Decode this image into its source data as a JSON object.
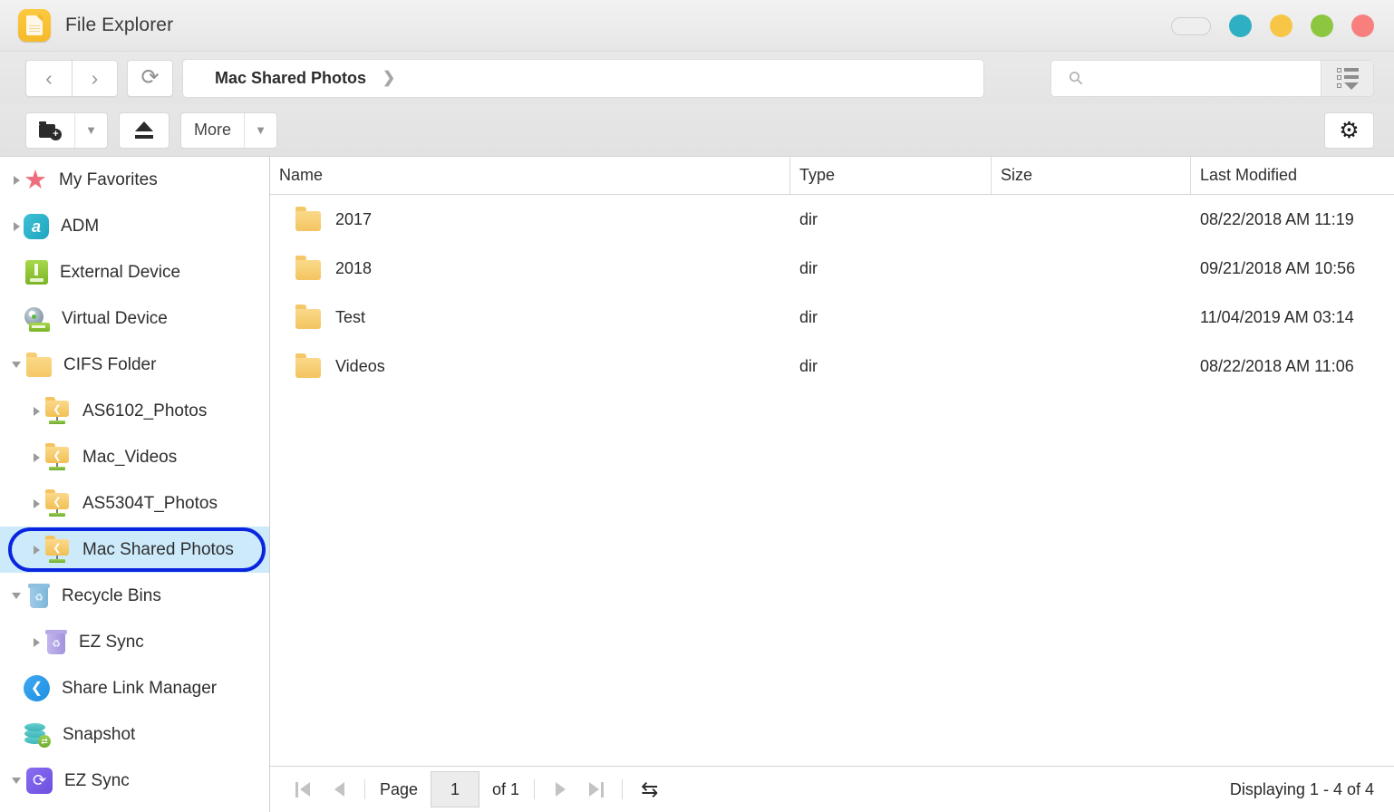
{
  "window": {
    "title": "File Explorer",
    "app_icon": "file-explorer-icon",
    "controls": {
      "pill": "",
      "dots": [
        {
          "name": "teal-dot",
          "color": "#2FAFC2"
        },
        {
          "name": "yellow-dot",
          "color": "#F7C646"
        },
        {
          "name": "green-dot",
          "color": "#8DC63F"
        },
        {
          "name": "red-dot",
          "color": "#F7807F"
        }
      ]
    }
  },
  "toolbar": {
    "back_icon": "‹",
    "forward_icon": "›",
    "refresh_icon": "⟳",
    "breadcrumb": {
      "label": "Mac Shared Photos",
      "separator": "❯"
    },
    "search": {
      "value": "",
      "placeholder": "",
      "icon": "search-icon"
    },
    "view_toggle": "view-list-dropdown-icon",
    "new_folder": {
      "icon": "new-folder-icon",
      "caret": "❯"
    },
    "eject": {
      "icon": "eject-icon"
    },
    "more": {
      "label": "More",
      "caret": "❯"
    },
    "settings": {
      "icon": "⚙"
    }
  },
  "sidebar": {
    "items": [
      {
        "label": "My Favorites",
        "icon": "star-icon",
        "twisty": "closed",
        "indent": 0,
        "selected": false
      },
      {
        "label": "ADM",
        "icon": "adm-icon",
        "twisty": "closed",
        "indent": 0,
        "selected": false
      },
      {
        "label": "External Device",
        "icon": "usb-device-icon",
        "twisty": "none",
        "indent": 0,
        "selected": false
      },
      {
        "label": "Virtual Device",
        "icon": "virtual-disc-icon",
        "twisty": "none",
        "indent": 0,
        "selected": false
      },
      {
        "label": "CIFS Folder",
        "icon": "folder-icon",
        "twisty": "open",
        "indent": 0,
        "selected": false
      },
      {
        "label": "AS6102_Photos",
        "icon": "shared-folder-icon",
        "twisty": "closed",
        "indent": 1,
        "selected": false
      },
      {
        "label": "Mac_Videos",
        "icon": "shared-folder-icon",
        "twisty": "closed",
        "indent": 1,
        "selected": false
      },
      {
        "label": "AS5304T_Photos",
        "icon": "shared-folder-icon",
        "twisty": "closed",
        "indent": 1,
        "selected": false
      },
      {
        "label": "Mac Shared Photos",
        "icon": "shared-folder-icon",
        "twisty": "closed",
        "indent": 1,
        "selected": true
      },
      {
        "label": "Recycle Bins",
        "icon": "trash-icon",
        "twisty": "open",
        "indent": 0,
        "selected": false
      },
      {
        "label": "EZ Sync",
        "icon": "trash-purple-icon",
        "twisty": "closed",
        "indent": 1,
        "selected": false
      },
      {
        "label": "Share Link Manager",
        "icon": "share-link-icon",
        "twisty": "none",
        "indent": 0,
        "selected": false
      },
      {
        "label": "Snapshot",
        "icon": "snapshot-icon",
        "twisty": "none",
        "indent": 0,
        "selected": false
      },
      {
        "label": "EZ Sync",
        "icon": "ezsync-icon",
        "twisty": "open",
        "indent": 0,
        "selected": false
      }
    ],
    "selection_border_color": "#0A25E0",
    "selection_fill_color": "#CDEAFB"
  },
  "filelist": {
    "columns": [
      "Name",
      "Type",
      "Size",
      "Last Modified"
    ],
    "rows": [
      {
        "name": "2017",
        "type": "dir",
        "size": "",
        "modified": "08/22/2018 AM 11:19",
        "icon": "folder-icon"
      },
      {
        "name": "2018",
        "type": "dir",
        "size": "",
        "modified": "09/21/2018 AM 10:56",
        "icon": "folder-icon"
      },
      {
        "name": "Test",
        "type": "dir",
        "size": "",
        "modified": "11/04/2019 AM 03:14",
        "icon": "folder-icon"
      },
      {
        "name": "Videos",
        "type": "dir",
        "size": "",
        "modified": "08/22/2018 AM 11:06",
        "icon": "folder-icon"
      }
    ]
  },
  "footer": {
    "first_page_icon": "first-page-icon",
    "prev_page_icon": "prev-page-icon",
    "page_label": "Page",
    "page_value": "1",
    "of_label": "of 1",
    "next_page_icon": "next-page-icon",
    "last_page_icon": "last-page-icon",
    "refresh_icon": "⇆",
    "displaying": "Displaying 1 - 4 of 4"
  }
}
